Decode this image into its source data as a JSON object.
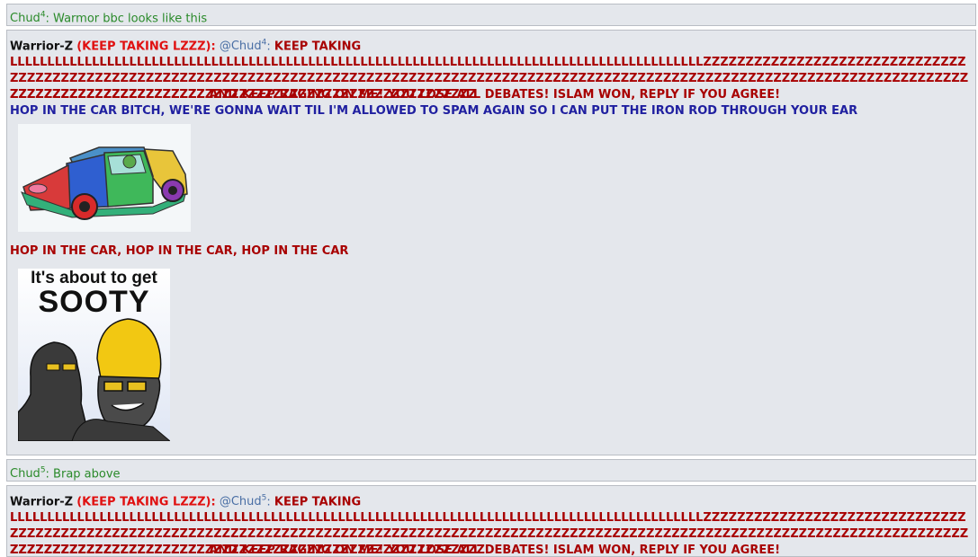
{
  "posts": [
    {
      "type": "short",
      "user": "Chud",
      "user_sup": "4",
      "text": ": Warmor bbc looks like this"
    },
    {
      "type": "long",
      "author": "Warrior-Z",
      "flair": "(KEEP TAKING LZZZ)",
      "sep": ":",
      "mention": "@Chud",
      "mention_sup": "4",
      "keep": "KEEP TAKING",
      "spam_l": "LLLLLLLLLLLLLLLLLLLLLLLLLLLLLLLLLLLLLLLLLLLLLLLLLLLLLLLLLLLLLLLLLLLLLLLLLLLLLLLLLLLLLLLLLLLLL",
      "spam_z1": "ZZZZZZZZZZZZZZZZZZZZZZZZZZZZZZZZZZZZZZZZZZZZZZZZZZZZZZZZZZZZZZZZZZZZZZZZZZZZZZZZZZZZZZZZZZZZZZZZZZZZZZZZZZZZZZZZZZZZZZZZZZZZZZZZZZZZZZZZZZZZZZZZZZZZZZZZZZZZZZZZZZZZZZZZZZZZZZZZZZZZZZZZZZZZZZZZZZZZZZZ",
      "spam_tail": "ZZZZZZZZZZZZZZZZZZZZZZZ AND KEEP RAGING ON ME! YOU LOSE ALL DEBATES! ISLAM WON, REPLY IF YOU AGREE!",
      "blue_line": "HOP IN THE CAR BITCH, WE'RE GONNA WAIT TIL I'M ALLOWED TO SPAM AGAIN SO I CAN PUT THE IRON ROD THROUGH YOUR EAR",
      "hop_line": "HOP IN THE CAR, HOP IN THE CAR, HOP IN THE CAR",
      "meme_title_1": "It's about to get",
      "meme_title_2": "SOOTY"
    },
    {
      "type": "short",
      "user": "Chud",
      "user_sup": "5",
      "text": ": Brap above"
    },
    {
      "type": "long",
      "author": "Warrior-Z",
      "flair": "(KEEP TAKING LZZZ)",
      "sep": ":",
      "mention": "@Chud",
      "mention_sup": "5",
      "keep": "KEEP TAKING",
      "spam_l": "LLLLLLLLLLLLLLLLLLLLLLLLLLLLLLLLLLLLLLLLLLLLLLLLLLLLLLLLLLLLLLLLLLLLLLLLLLLLLLLLLLLLLLLLLLLLL",
      "spam_z1": "ZZZZZZZZZZZZZZZZZZZZZZZZZZZZZZZZZZZZZZZZZZZZZZZZZZZZZZZZZZZZZZZZZZZZZZZZZZZZZZZZZZZZZZZZZZZZZZZZZZZZZZZZZZZZZZZZZZZZZZZZZZZZZZZZZZZZZZZZZZZZZZZZZZZZZZZZZZZZZZZZZZZZZZZZZZZZZZZZZZZZZZZZZZZZZZZZZZZZZZZZ",
      "spam_tail": "ZZZZZZZZZZZZZZZZZZZZZZZ AND KEEP RAGING ON ME! YOU LOSE ALL DEBATES! ISLAM WON, REPLY IF YOU AGREE!"
    }
  ],
  "colors": {
    "panel_bg": "#e4e7ec",
    "border": "#b9bdc4",
    "green": "#2a8a2a",
    "red": "#a80000",
    "flair_red": "#e01010",
    "blue": "#2020a0",
    "mention": "#4a6fa5"
  }
}
